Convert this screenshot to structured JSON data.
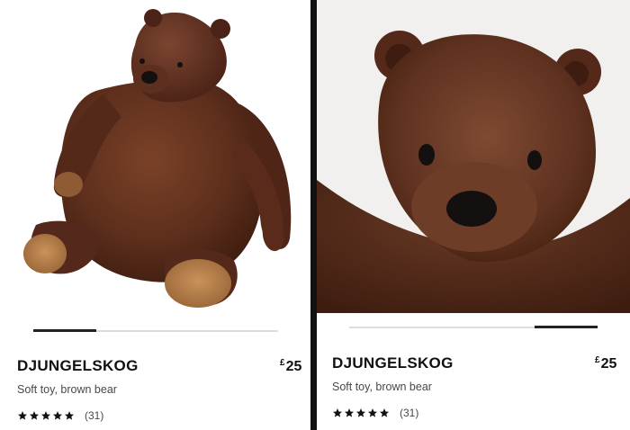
{
  "products": [
    {
      "name": "DJUNGELSKOG",
      "description": "Soft toy, brown bear",
      "price_currency": "£",
      "price_value": "25",
      "rating_stars": 5,
      "review_count": "(31)",
      "image_alt": "brown bear soft toy, full body"
    },
    {
      "name": "DJUNGELSKOG",
      "description": "Soft toy, brown bear",
      "price_currency": "£",
      "price_value": "25",
      "rating_stars": 5,
      "review_count": "(31)",
      "image_alt": "brown bear soft toy, close-up face"
    }
  ],
  "colors": {
    "fur_dark": "#4a2416",
    "fur_mid": "#6b3a24",
    "fur_light": "#8a5638",
    "paw_pad": "#b8824f",
    "text_primary": "#111111",
    "text_secondary": "#484848"
  }
}
